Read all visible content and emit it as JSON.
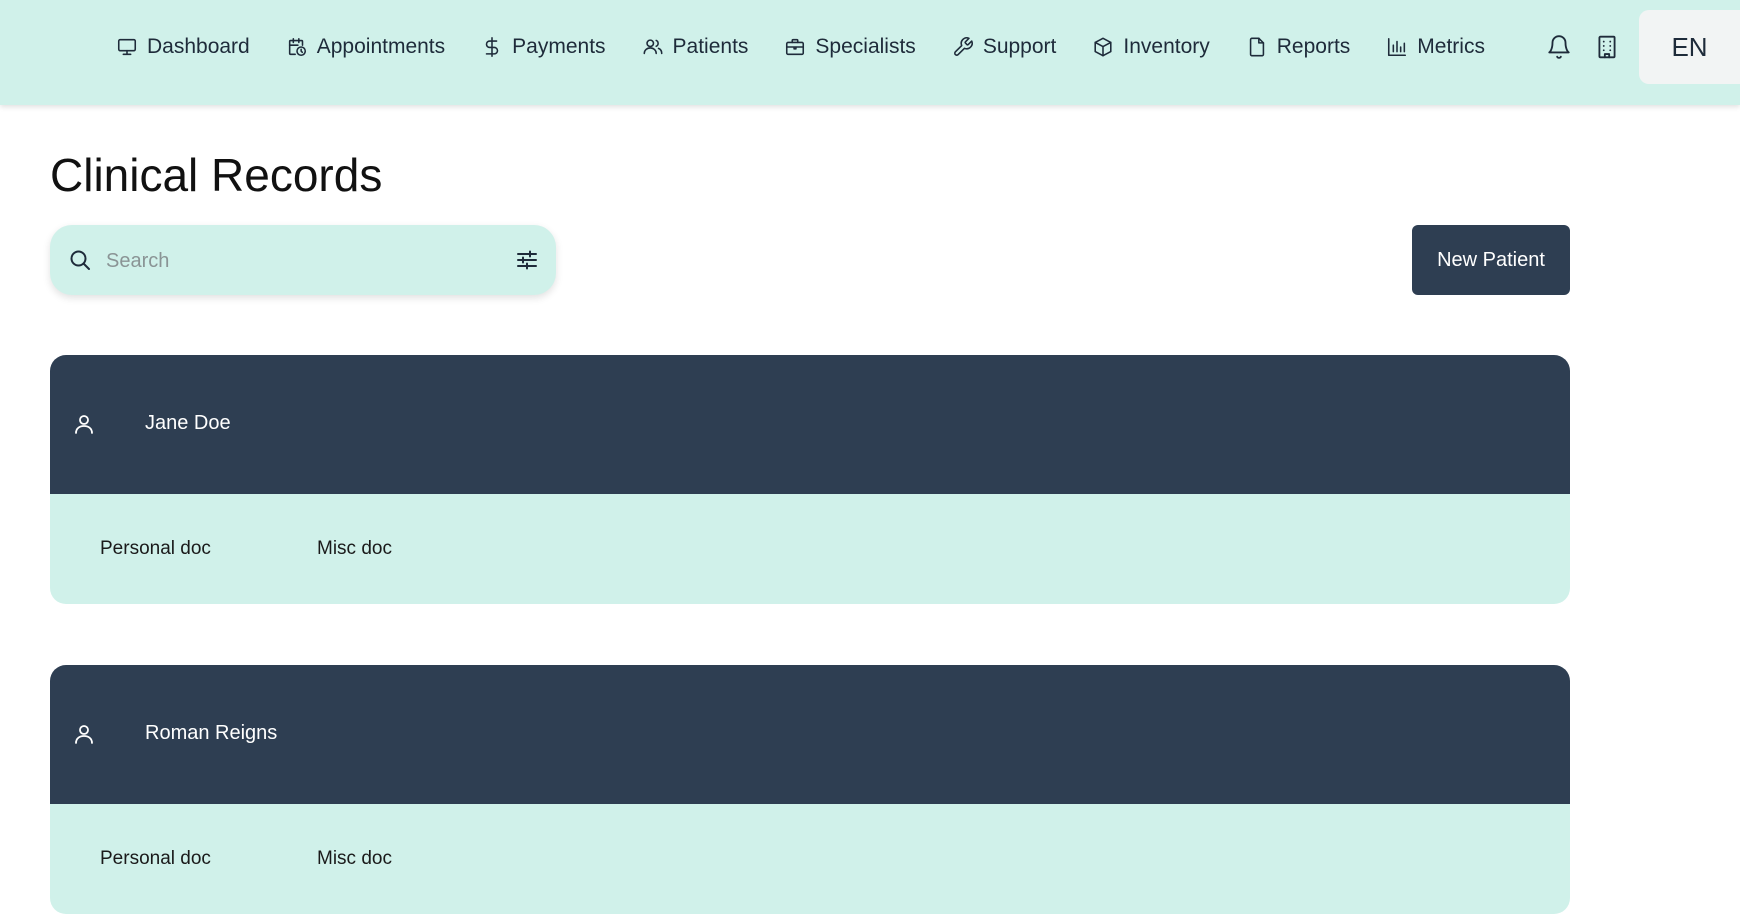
{
  "nav": {
    "items": [
      {
        "label": "Dashboard",
        "icon": "monitor-icon"
      },
      {
        "label": "Appointments",
        "icon": "calendar-clock-icon"
      },
      {
        "label": "Payments",
        "icon": "dollar-icon"
      },
      {
        "label": "Patients",
        "icon": "users-icon"
      },
      {
        "label": "Specialists",
        "icon": "briefcase-icon"
      },
      {
        "label": "Support",
        "icon": "wrench-icon"
      },
      {
        "label": "Inventory",
        "icon": "box-icon"
      },
      {
        "label": "Reports",
        "icon": "file-icon"
      },
      {
        "label": "Metrics",
        "icon": "bar-chart-icon"
      }
    ],
    "notifications_icon": "bell-icon",
    "building_icon": "building-icon",
    "language": "EN"
  },
  "page": {
    "title": "Clinical Records"
  },
  "search": {
    "placeholder": "Search",
    "value": "",
    "icon": "search-icon",
    "filter_icon": "sliders-icon"
  },
  "actions": {
    "new_patient": "New Patient"
  },
  "records": [
    {
      "name": "Jane Doe",
      "icon": "user-icon",
      "docs": [
        "Personal doc",
        "Misc doc"
      ]
    },
    {
      "name": "Roman Reigns",
      "icon": "user-icon",
      "docs": [
        "Personal doc",
        "Misc doc"
      ]
    }
  ],
  "colors": {
    "accent_light": "#d0f1ea",
    "primary_dark": "#2e3e52"
  }
}
